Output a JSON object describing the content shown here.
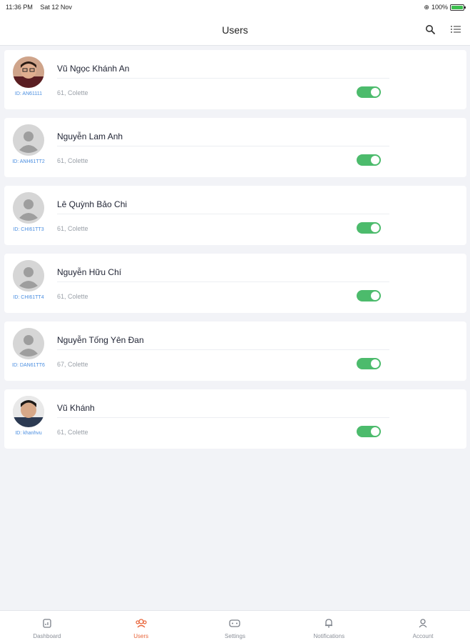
{
  "status_bar": {
    "time": "11:36 PM",
    "date": "Sat 12 Nov",
    "signal": "⊕",
    "battery_percent": "100%"
  },
  "header": {
    "title": "Users"
  },
  "icons": {
    "search": "search-icon",
    "list": "list-icon"
  },
  "colors": {
    "accent": "#e8653a",
    "toggle_on": "#4cbb6c",
    "id_link": "#4a8ee0"
  },
  "users": [
    {
      "name": "Vũ Ngọc Khánh An",
      "id": "ID: AN61111",
      "subtitle": "61, Colette",
      "active": true,
      "avatar": "photo"
    },
    {
      "name": "Nguyễn Lam Anh",
      "id": "ID: ANH61TT2",
      "subtitle": "61, Colette",
      "active": true,
      "avatar": "placeholder"
    },
    {
      "name": "Lê Quỳnh Bảo Chi",
      "id": "ID: CHI61TT3",
      "subtitle": "61, Colette",
      "active": true,
      "avatar": "placeholder"
    },
    {
      "name": "Nguyễn Hữu Chí",
      "id": "ID: CHI61TT4",
      "subtitle": "61, Colette",
      "active": true,
      "avatar": "placeholder"
    },
    {
      "name": "Nguyễn Tống Yên Đan",
      "id": "ID: DAN61TT6",
      "subtitle": "67, Colette",
      "active": true,
      "avatar": "placeholder"
    },
    {
      "name": "Vũ Khánh",
      "id": "ID: khanhvu",
      "subtitle": "61, Colette",
      "active": true,
      "avatar": "photo"
    }
  ],
  "tabs": [
    {
      "label": "Dashboard",
      "icon": "dashboard-icon",
      "active": false
    },
    {
      "label": "Users",
      "icon": "users-icon",
      "active": true
    },
    {
      "label": "Settings",
      "icon": "settings-icon",
      "active": false
    },
    {
      "label": "Notifications",
      "icon": "bell-icon",
      "active": false
    },
    {
      "label": "Account",
      "icon": "account-icon",
      "active": false
    }
  ]
}
